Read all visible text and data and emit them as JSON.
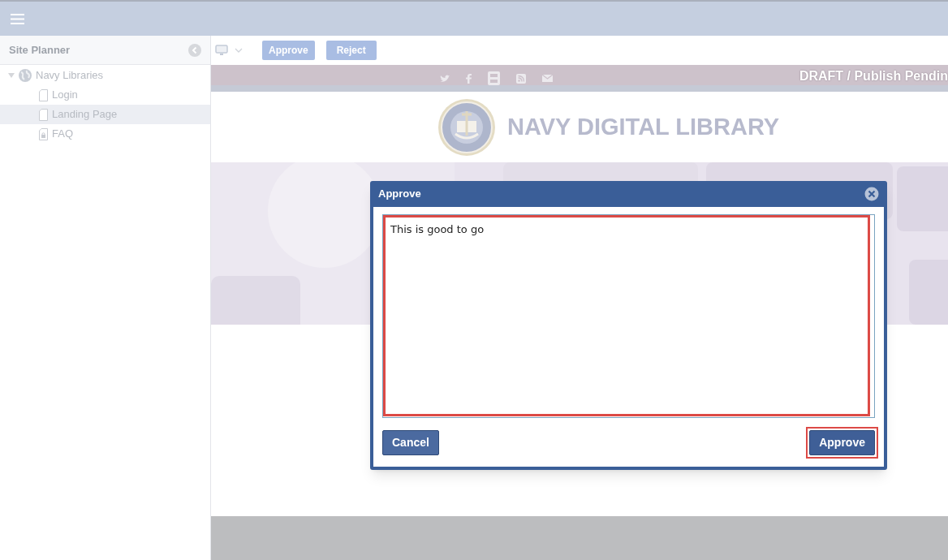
{
  "sidebar": {
    "title": "Site Planner",
    "tree": [
      {
        "label": "Navy Libraries",
        "kind": "site",
        "expanded": true,
        "selected": false,
        "children": [
          {
            "label": "Login",
            "kind": "page",
            "selected": false
          },
          {
            "label": "Landing Page",
            "kind": "page",
            "selected": true
          },
          {
            "label": "FAQ",
            "kind": "locked-page",
            "selected": false
          }
        ]
      }
    ]
  },
  "toolbar": {
    "buttons": [
      "Approve",
      "Reject"
    ]
  },
  "preview": {
    "status": "DRAFT / Publish Pendin",
    "site_title": "NAVY DIGITAL LIBRARY"
  },
  "dialog": {
    "title": "Approve",
    "comment": "This is good to go",
    "buttons": [
      {
        "label": "Cancel",
        "kind": "secondary",
        "highlighted": false
      },
      {
        "label": "Approve",
        "kind": "primary",
        "highlighted": true
      }
    ],
    "comment_highlighted": true
  }
}
